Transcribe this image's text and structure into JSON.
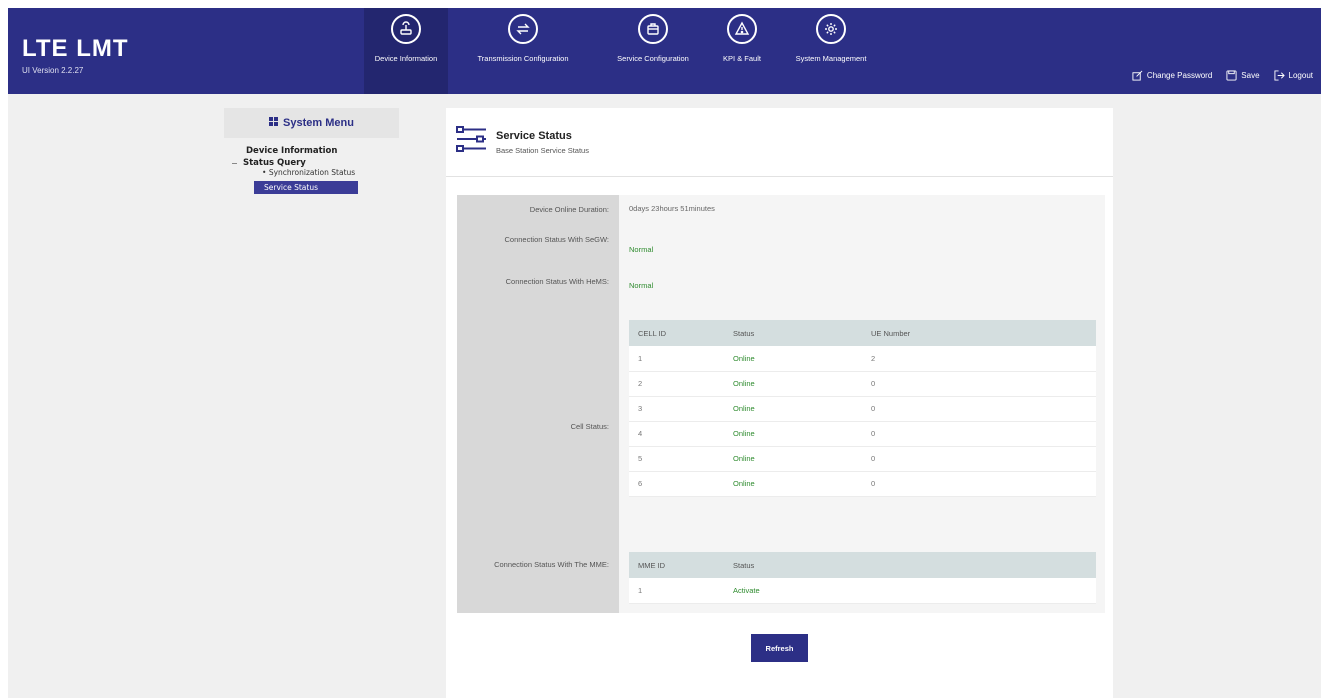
{
  "app": {
    "title": "LTE LMT",
    "version": "UI Version 2.2.27"
  },
  "nav": [
    {
      "label": "Device Information",
      "icon": "router-icon",
      "active": true
    },
    {
      "label": "Transmission Configuration",
      "icon": "transfer-icon",
      "active": false
    },
    {
      "label": "Service Configuration",
      "icon": "briefcase-icon",
      "active": false
    },
    {
      "label": "KPI & Fault",
      "icon": "warning-icon",
      "active": false
    },
    {
      "label": "System Management",
      "icon": "gear-icon",
      "active": false
    }
  ],
  "tools": {
    "change_password": "Change Password",
    "save": "Save",
    "logout": "Logout"
  },
  "sidebar": {
    "title": "System Menu",
    "top_item": "Device Information",
    "group": "Status Query",
    "child": "Synchronization Status",
    "active": "Service Status"
  },
  "page": {
    "title": "Service Status",
    "subtitle": "Base Station Service Status"
  },
  "fields": {
    "online_duration_label": "Device Online Duration:",
    "online_duration_value": "0days 23hours 51minutes",
    "segw_label": "Connection Status With SeGW:",
    "segw_value": "Normal",
    "hems_label": "Connection Status With HeMS:",
    "hems_value": "Normal",
    "cell_status_label": "Cell Status:",
    "mme_label": "Connection Status With The MME:"
  },
  "cell_table": {
    "headers": [
      "CELL ID",
      "Status",
      "UE Number"
    ],
    "rows": [
      [
        "1",
        "Online",
        "2"
      ],
      [
        "2",
        "Online",
        "0"
      ],
      [
        "3",
        "Online",
        "0"
      ],
      [
        "4",
        "Online",
        "0"
      ],
      [
        "5",
        "Online",
        "0"
      ],
      [
        "6",
        "Online",
        "0"
      ]
    ]
  },
  "mme_table": {
    "headers": [
      "MME ID",
      "Status"
    ],
    "rows": [
      [
        "1",
        "Activate"
      ]
    ]
  },
  "refresh_label": "Refresh",
  "colors": {
    "brand": "#2c2f86",
    "status_ok": "#2e8b2e",
    "table_header": "#d4dedf"
  }
}
